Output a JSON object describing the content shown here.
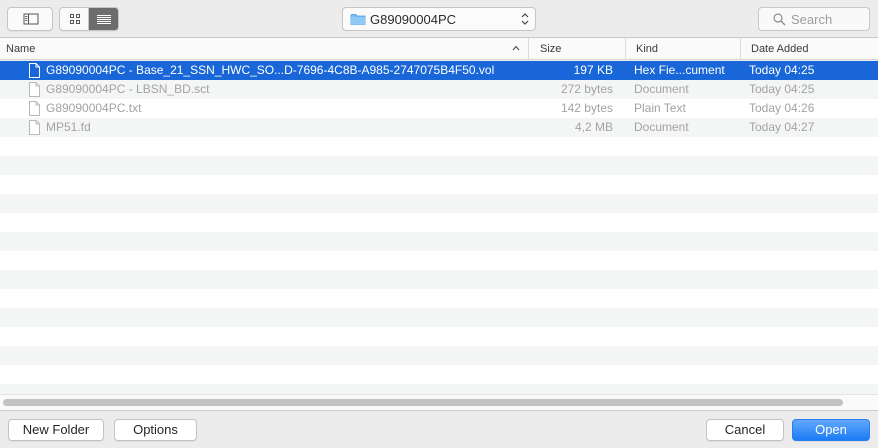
{
  "toolbar": {
    "location": "G89090004PC",
    "search_placeholder": "Search"
  },
  "columns": {
    "name": "Name",
    "size": "Size",
    "kind": "Kind",
    "date_added": "Date Added"
  },
  "files": [
    {
      "name": "G89090004PC - Base_21_SSN_HWC_SO...D-7696-4C8B-A985-2747075B4F50.vol",
      "size": "197 KB",
      "kind": "Hex Fie...cument",
      "date_added": "Today 04:25",
      "selected": true,
      "enabled": true
    },
    {
      "name": "G89090004PC - LBSN_BD.sct",
      "size": "272 bytes",
      "kind": "Document",
      "date_added": "Today 04:25",
      "selected": false,
      "enabled": false
    },
    {
      "name": "G89090004PC.txt",
      "size": "142 bytes",
      "kind": "Plain Text",
      "date_added": "Today 04:26",
      "selected": false,
      "enabled": false
    },
    {
      "name": "MP51.fd",
      "size": "4,2 MB",
      "kind": "Document",
      "date_added": "Today 04:27",
      "selected": false,
      "enabled": false
    }
  ],
  "buttons": {
    "new_folder": "New Folder",
    "options": "Options",
    "cancel": "Cancel",
    "open": "Open"
  },
  "colors": {
    "selection": "#1866d8",
    "default_button": "#1b7cf5",
    "dimmed_text": "#a3a3a3"
  }
}
